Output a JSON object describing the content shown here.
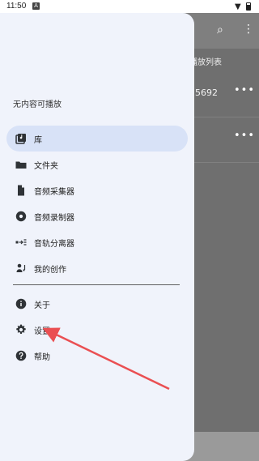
{
  "status_bar": {
    "time": "11:50",
    "notification_icon": "A"
  },
  "drawer": {
    "header_text": "无内容可播放",
    "items": [
      {
        "label": "库",
        "icon": "library-icon",
        "active": true
      },
      {
        "label": "文件夹",
        "icon": "folder-icon"
      },
      {
        "label": "音频采集器",
        "icon": "file-icon"
      },
      {
        "label": "音频录制器",
        "icon": "record-icon"
      },
      {
        "label": "音轨分离器",
        "icon": "separator-icon"
      },
      {
        "label": "我的创作",
        "icon": "person-music-icon"
      },
      {
        "label": "关于",
        "icon": "info-icon"
      },
      {
        "label": "设置",
        "icon": "gear-icon"
      },
      {
        "label": "帮助",
        "icon": "help-icon"
      }
    ]
  },
  "background": {
    "tab_text": "播放列表",
    "row_text": "5692",
    "menu_text": "•••"
  },
  "colors": {
    "accent_red": "#ea4f52",
    "drawer_bg": "#f0f3fb",
    "active_item_bg": "#d8e2f7"
  }
}
